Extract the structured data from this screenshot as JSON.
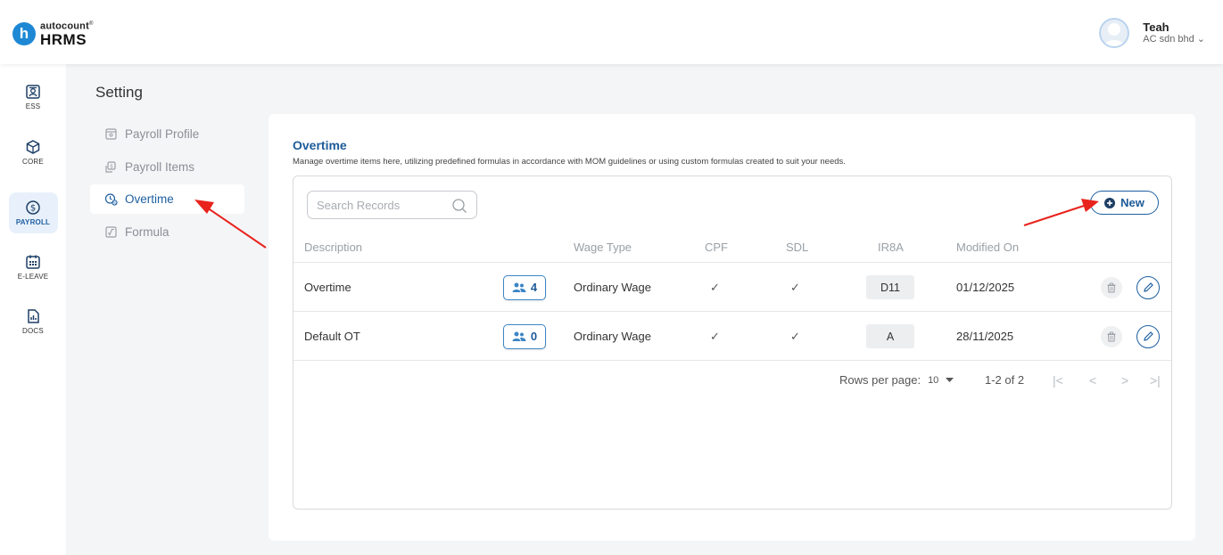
{
  "header": {
    "logo_letter": "h",
    "logo_brand": "autocount",
    "logo_brand_mark": "®",
    "logo_product": "HRMS",
    "user_name": "Teah",
    "user_company": "AC sdn bhd",
    "company_chevron": "⌄"
  },
  "rail": {
    "items": [
      {
        "label": "ESS",
        "icon": "id-card-icon"
      },
      {
        "label": "CORE",
        "icon": "cube-icon"
      },
      {
        "label": "PAYROLL",
        "icon": "dollar-circle-icon"
      },
      {
        "label": "E-LEAVE",
        "icon": "calendar-icon"
      },
      {
        "label": "DOCS",
        "icon": "document-chart-icon"
      }
    ],
    "active": "PAYROLL"
  },
  "setting": {
    "title": "Setting",
    "menu": [
      {
        "label": "Payroll Profile",
        "icon": "profile-doc-icon"
      },
      {
        "label": "Payroll Items",
        "icon": "items-stack-icon"
      },
      {
        "label": "Overtime",
        "icon": "clock-percent-icon"
      },
      {
        "label": "Formula",
        "icon": "formula-icon"
      }
    ],
    "active": "Overtime"
  },
  "card": {
    "title": "Overtime",
    "subtitle": "Manage overtime items here, utilizing predefined formulas in accordance with MOM guidelines or using custom formulas created to suit your needs."
  },
  "toolbar": {
    "search_placeholder": "Search Records",
    "new_label": "New"
  },
  "table": {
    "headers": {
      "description": "Description",
      "wage_type": "Wage Type",
      "cpf": "CPF",
      "sdl": "SDL",
      "ir8a": "IR8A",
      "modified_on": "Modified On"
    },
    "rows": [
      {
        "description": "Overtime",
        "count": "4",
        "wage_type": "Ordinary Wage",
        "cpf": "✓",
        "sdl": "✓",
        "ir8a": "D11",
        "modified_on": "01/12/2025"
      },
      {
        "description": "Default OT",
        "count": "0",
        "wage_type": "Ordinary Wage",
        "cpf": "✓",
        "sdl": "✓",
        "ir8a": "A",
        "modified_on": "28/11/2025"
      }
    ]
  },
  "pagination": {
    "rows_per_page_label": "Rows per page:",
    "rows_per_page_value": "10",
    "range": "1-2 of 2",
    "first": "|<",
    "prev": "<",
    "next": ">",
    "last": ">|"
  },
  "colors": {
    "primary": "#1e5fa0",
    "annotation_arrow": "#e8231d"
  }
}
